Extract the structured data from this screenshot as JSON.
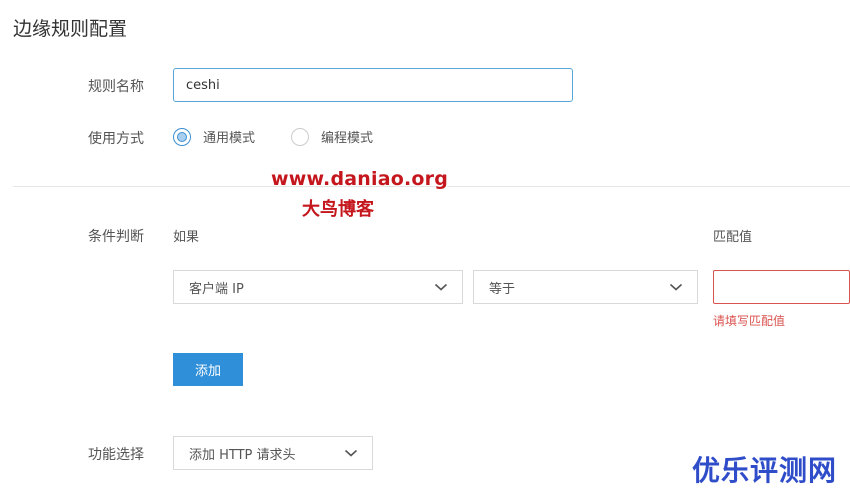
{
  "page": {
    "title": "边缘规则配置"
  },
  "form": {
    "rule_name_label": "规则名称",
    "rule_name_value": "ceshi",
    "usage_label": "使用方式",
    "usage_options": [
      {
        "label": "通用模式",
        "checked": true
      },
      {
        "label": "编程模式",
        "checked": false
      }
    ],
    "condition_label": "条件判断",
    "if_label": "如果",
    "match_value_label": "匹配值",
    "condition_field": "客户端 IP",
    "operator": "等于",
    "match_value": "",
    "match_value_error": "请填写匹配值",
    "add_button_label": "添加",
    "feature_label": "功能选择",
    "feature_value": "添加 HTTP 请求头"
  },
  "watermarks": {
    "url": "www.daniao.org",
    "name": "大鸟博客",
    "corner": "优乐评测网"
  },
  "colors": {
    "accent": "#2f8fd8",
    "error": "#d9534f",
    "input_focus_border": "#5aa5d8",
    "watermark_red": "#c4161c",
    "watermark_blue": "#2f4cc9"
  },
  "icons": {
    "dropdown": "chevron-down-icon"
  }
}
